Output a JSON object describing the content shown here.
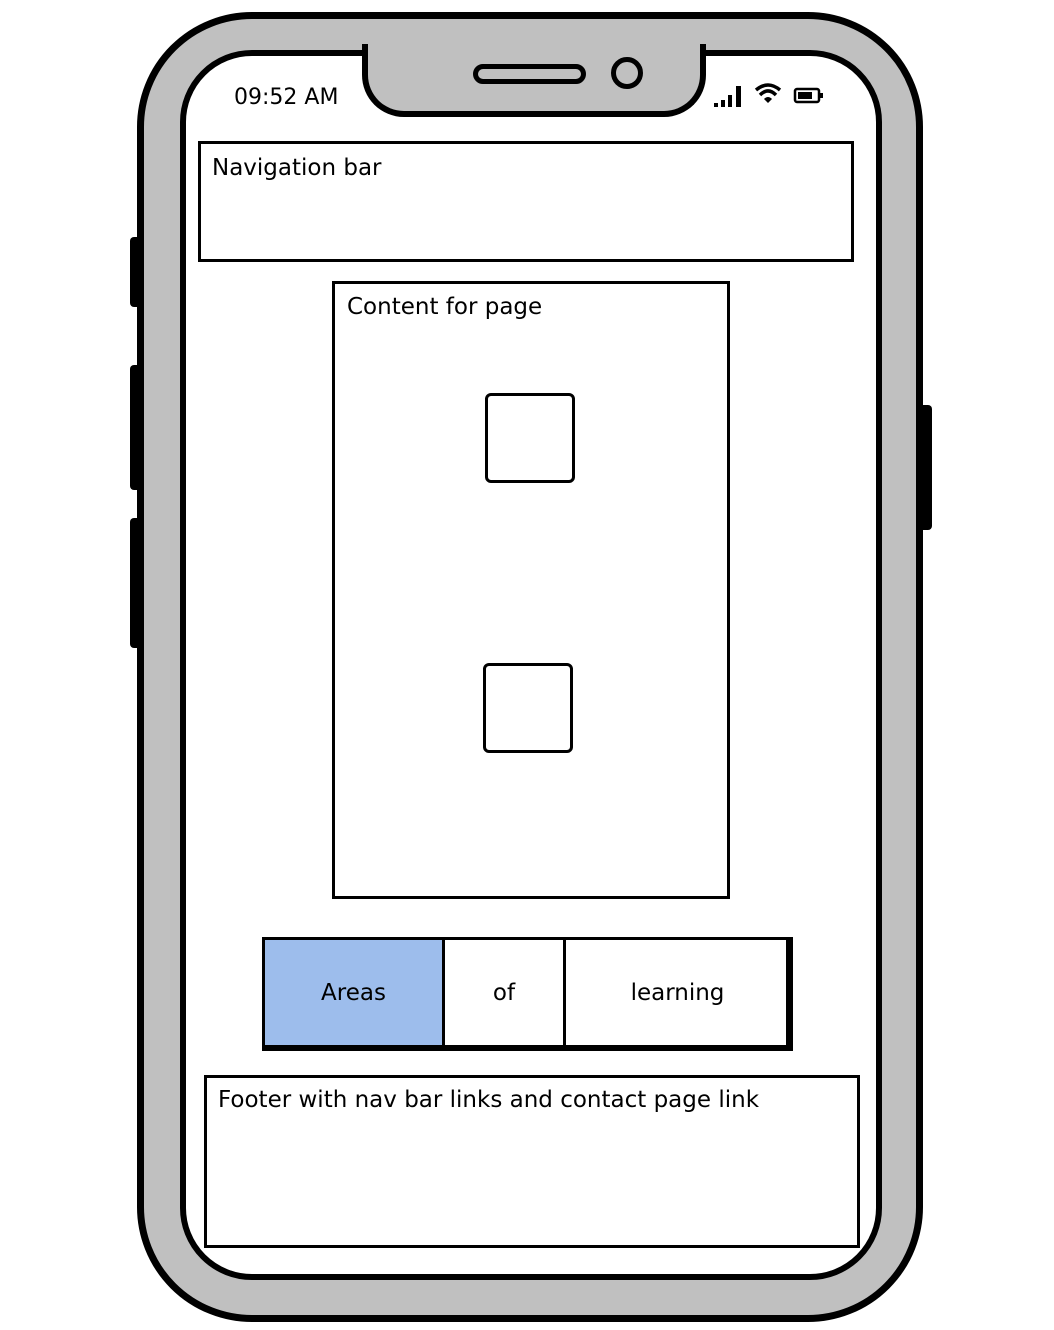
{
  "status_bar": {
    "time": "09:52 AM"
  },
  "nav_bar": {
    "label": "Navigation bar"
  },
  "content": {
    "label": "Content for page"
  },
  "tabs": [
    {
      "label": "Areas",
      "selected": true
    },
    {
      "label": "of",
      "selected": false
    },
    {
      "label": "learning",
      "selected": false
    }
  ],
  "footer": {
    "label": "Footer with nav bar links and contact page link"
  },
  "colors": {
    "selected_tab": "#9DBDEC",
    "device": "#C0C0C0"
  }
}
